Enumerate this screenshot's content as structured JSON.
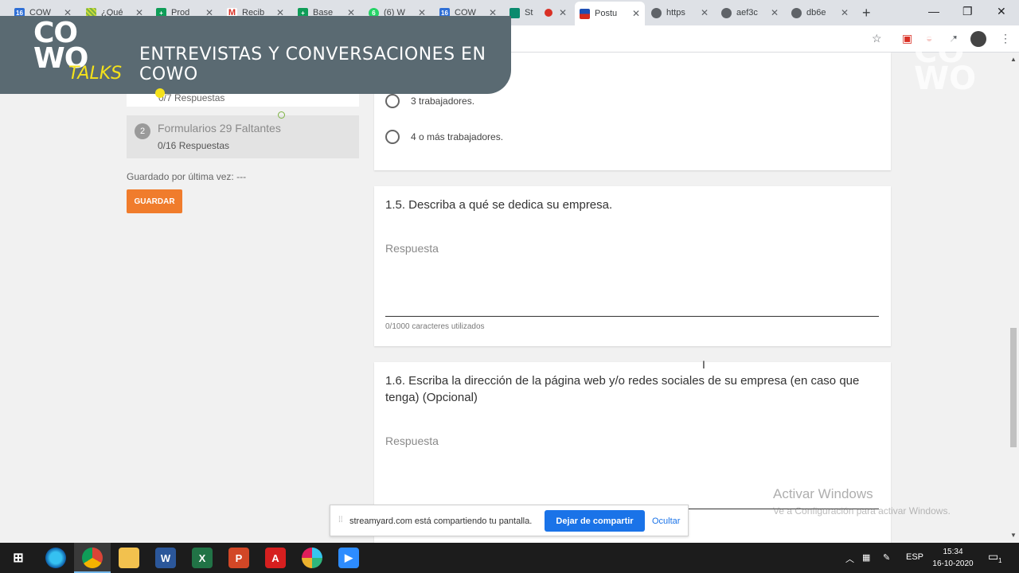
{
  "browser": {
    "tabs": [
      {
        "label": "COW",
        "icon": "calendar-icon",
        "color": "#2f6fd6",
        "badge": "16"
      },
      {
        "label": "¿Qué",
        "icon": "stripes-icon",
        "color": "#7cb342",
        "badge": ""
      },
      {
        "label": "Prod",
        "icon": "sheets-icon",
        "color": "#0f9d58",
        "badge": ""
      },
      {
        "label": "Recib",
        "icon": "gmail-icon",
        "color": "#d93025",
        "badge": ""
      },
      {
        "label": "Base",
        "icon": "sheets-icon",
        "color": "#0f9d58",
        "badge": ""
      },
      {
        "label": "(6) W",
        "icon": "whatsapp-icon",
        "color": "#25d366",
        "badge": ""
      },
      {
        "label": "COW",
        "icon": "calendar-icon",
        "color": "#2f6fd6",
        "badge": "16"
      },
      {
        "label": "St",
        "icon": "streamyard-icon",
        "color": "#0b8a6e",
        "badge": ""
      },
      {
        "label": "Postu",
        "icon": "flag-icon",
        "color": "#d52b1e",
        "badge": ""
      },
      {
        "label": "https",
        "icon": "globe-icon",
        "color": "#5f6368",
        "badge": ""
      },
      {
        "label": "aef3c",
        "icon": "globe-icon",
        "color": "#5f6368",
        "badge": ""
      },
      {
        "label": "db6e",
        "icon": "globe-icon",
        "color": "#5f6368",
        "badge": ""
      }
    ]
  },
  "overlay": {
    "logo_top": "CO",
    "logo_bottom": "WO",
    "logo_sub": "TALKS",
    "title": "ENTREVISTAS Y CONVERSACIONES EN COWO",
    "yellow": "#f5e21a"
  },
  "sidebar": {
    "card1_text": "0/7 Respuestas",
    "card2_number": "2",
    "card2_title": "Formularios 29 Faltantes",
    "card2_sub": "0/16 Respuestas",
    "saved_text": "Guardado por última vez: ---",
    "save_button": "GUARDAR",
    "accent": "#f07c2c"
  },
  "form": {
    "options": [
      "3 trabajadores.",
      "4 o más trabajadores."
    ],
    "q15": {
      "title": "1.5. Describa a qué se dedica su empresa.",
      "placeholder": "Respuesta",
      "counter": "0/1000 caracteres utilizados"
    },
    "q16": {
      "title": "1.6. Escriba la dirección de la página web y/o redes sociales de su empresa (en caso que tenga) (Opcional)",
      "placeholder": "Respuesta"
    }
  },
  "windows": {
    "activate_title": "Activar Windows",
    "activate_sub": "Ve a Configuración para activar Windows."
  },
  "sharebar": {
    "message": "streamyard.com está compartiendo tu pantalla.",
    "stop_button": "Dejar de compartir",
    "hide_link": "Ocultar",
    "accent": "#1a73e8"
  },
  "taskbar": {
    "lang": "ESP",
    "time": "15:34",
    "date": "16-10-2020",
    "notifications": "1"
  }
}
